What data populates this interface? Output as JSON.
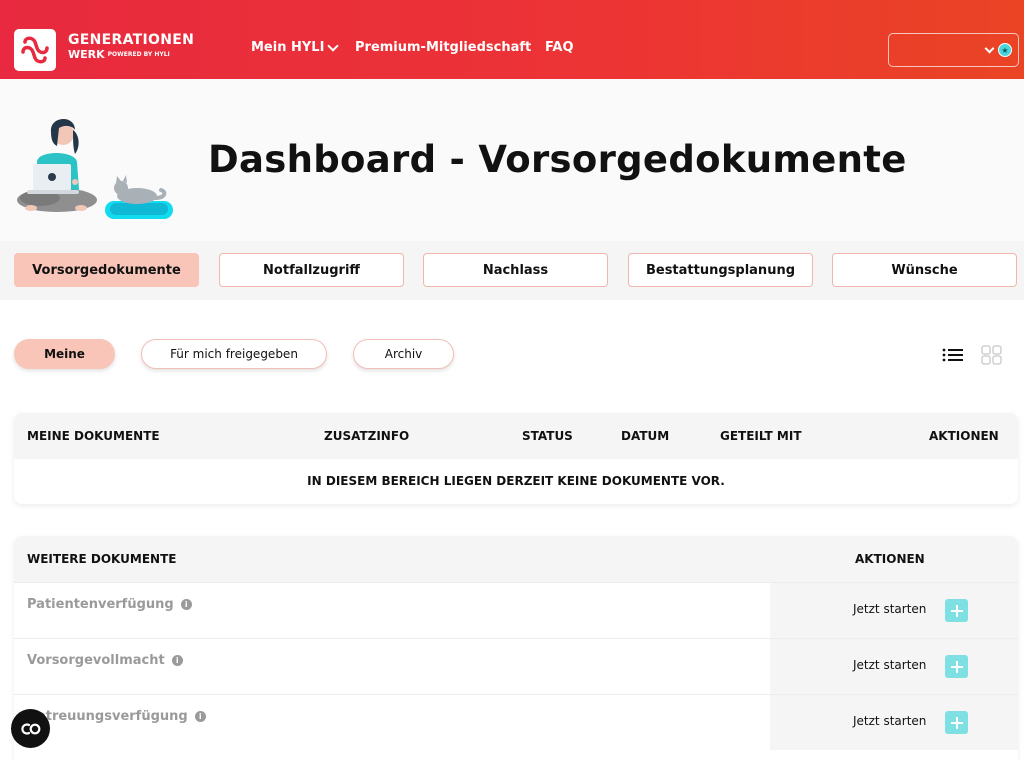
{
  "header": {
    "logo_line1": "GENERATIONEN",
    "logo_line2": "WERK",
    "logo_powered": "POWERED BY HYLI",
    "nav": [
      {
        "label": "Mein HYLI"
      },
      {
        "label": "Premium-Mitgliedschaft"
      },
      {
        "label": "FAQ"
      }
    ],
    "select_value": ""
  },
  "hero": {
    "title": "Dashboard - Vorsorgedokumente"
  },
  "tabs": [
    {
      "label": "Vorsorgedokumente",
      "active": true
    },
    {
      "label": "Notfallzugriff"
    },
    {
      "label": "Nachlass"
    },
    {
      "label": "Bestattungsplanung"
    },
    {
      "label": "Wünsche"
    }
  ],
  "filters": [
    {
      "label": "Meine",
      "active": true
    },
    {
      "label": "Für mich freigegeben"
    },
    {
      "label": "Archiv"
    }
  ],
  "my_documents": {
    "columns": [
      "MEINE DOKUMENTE",
      "ZUSATZINFO",
      "STATUS",
      "DATUM",
      "GETEILT MIT",
      "AKTIONEN"
    ],
    "empty_message": "IN DIESEM BEREICH LIEGEN DERZEIT KEINE DOKUMENTE VOR."
  },
  "more_documents": {
    "columns": [
      "WEITERE DOKUMENTE",
      "AKTIONEN"
    ],
    "rows": [
      {
        "name": "Patientenverfügung",
        "action": "Jetzt starten"
      },
      {
        "name": "Vorsorgevollmacht",
        "action": "Jetzt starten"
      },
      {
        "name": "Betreuungsverfügung",
        "action": "Jetzt starten"
      }
    ]
  },
  "colors": {
    "brand_red": "#e8293f",
    "accent_peach": "#f8c5b8",
    "accent_teal": "#7fe0e3"
  },
  "icons": {
    "fab": "co-chat-icon",
    "list_view": "list-view-icon",
    "grid_view": "grid-view-icon"
  }
}
